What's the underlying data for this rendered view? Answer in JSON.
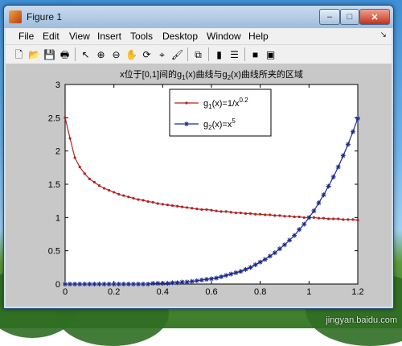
{
  "window": {
    "title": "Figure 1",
    "controls": {
      "minimize": "–",
      "maximize": "□",
      "close": "✕"
    }
  },
  "menu": [
    "File",
    "Edit",
    "View",
    "Insert",
    "Tools",
    "Desktop",
    "Window",
    "Help"
  ],
  "menu_arrow": "↘",
  "toolbar": [
    {
      "name": "new-figure-icon",
      "glyph": "🗋"
    },
    {
      "name": "open-file-icon",
      "glyph": "📂"
    },
    {
      "name": "save-icon",
      "glyph": "💾"
    },
    {
      "name": "print-icon",
      "glyph": "🖶"
    },
    {
      "sep": true
    },
    {
      "name": "edit-plot-arrow-icon",
      "glyph": "↖"
    },
    {
      "name": "zoom-in-icon",
      "glyph": "⊕"
    },
    {
      "name": "zoom-out-icon",
      "glyph": "⊖"
    },
    {
      "name": "pan-hand-icon",
      "glyph": "✋"
    },
    {
      "name": "rotate-3d-icon",
      "glyph": "⟳"
    },
    {
      "name": "data-cursor-icon",
      "glyph": "⌖"
    },
    {
      "name": "brush-icon",
      "glyph": "🖌"
    },
    {
      "sep": true
    },
    {
      "name": "link-plot-icon",
      "glyph": "⧉"
    },
    {
      "sep": true
    },
    {
      "name": "insert-colorbar-icon",
      "glyph": "▮"
    },
    {
      "name": "insert-legend-icon",
      "glyph": "☰"
    },
    {
      "sep": true
    },
    {
      "name": "hide-plot-tools-icon",
      "glyph": "■"
    },
    {
      "name": "show-plot-tools-icon",
      "glyph": "▣"
    }
  ],
  "chart_data": {
    "type": "line",
    "title": "x位于[0,1]间的g1(x)曲线与g2(x)曲线所夹的区域",
    "xlim": [
      0,
      1.2
    ],
    "ylim": [
      0,
      3
    ],
    "xticks": [
      "0",
      "0.2",
      "0.4",
      "0.6",
      "0.8",
      "1",
      "1.2"
    ],
    "yticks": [
      "0",
      "0.5",
      "1",
      "1.5",
      "2",
      "2.5",
      "3"
    ],
    "x": [
      0.02,
      0.04,
      0.06,
      0.08,
      0.1,
      0.12,
      0.14,
      0.16,
      0.18,
      0.2,
      0.22,
      0.24,
      0.26,
      0.28,
      0.3,
      0.32,
      0.34,
      0.36,
      0.38,
      0.4,
      0.42,
      0.44,
      0.46,
      0.48,
      0.5,
      0.52,
      0.54,
      0.56,
      0.58,
      0.6,
      0.62,
      0.64,
      0.66,
      0.68,
      0.7,
      0.72,
      0.74,
      0.76,
      0.78,
      0.8,
      0.82,
      0.84,
      0.86,
      0.88,
      0.9,
      0.92,
      0.94,
      0.96,
      0.98,
      1.0,
      1.02,
      1.04,
      1.06,
      1.08,
      1.1,
      1.12,
      1.14,
      1.16,
      1.18,
      1.2
    ],
    "series": [
      {
        "name": "g1(x)=1/x^0.2",
        "color": "#b22222",
        "marker": "dot",
        "values": [
          2.19,
          1.9,
          1.76,
          1.66,
          1.58,
          1.53,
          1.48,
          1.44,
          1.41,
          1.38,
          1.35,
          1.33,
          1.31,
          1.29,
          1.27,
          1.26,
          1.24,
          1.23,
          1.21,
          1.2,
          1.19,
          1.18,
          1.17,
          1.16,
          1.15,
          1.14,
          1.13,
          1.12,
          1.12,
          1.11,
          1.1,
          1.09,
          1.09,
          1.08,
          1.07,
          1.07,
          1.06,
          1.06,
          1.05,
          1.05,
          1.04,
          1.04,
          1.03,
          1.03,
          1.02,
          1.02,
          1.01,
          1.01,
          1.0,
          1.0,
          1.0,
          0.99,
          0.99,
          0.98,
          0.98,
          0.98,
          0.97,
          0.97,
          0.97,
          0.96
        ]
      },
      {
        "name": "g2(x)=x^5",
        "color": "#1a2a8c",
        "marker": "star",
        "values": [
          0.0,
          0.0,
          0.0,
          0.0,
          0.0,
          0.0,
          0.0,
          0.0,
          0.0,
          0.0,
          0.0,
          0.0,
          0.0,
          0.0,
          0.0,
          0.0,
          0.0,
          0.01,
          0.01,
          0.01,
          0.01,
          0.02,
          0.02,
          0.03,
          0.03,
          0.04,
          0.05,
          0.06,
          0.07,
          0.08,
          0.09,
          0.11,
          0.13,
          0.15,
          0.17,
          0.19,
          0.22,
          0.25,
          0.29,
          0.33,
          0.37,
          0.42,
          0.47,
          0.53,
          0.59,
          0.66,
          0.73,
          0.82,
          0.9,
          1.0,
          1.1,
          1.22,
          1.34,
          1.47,
          1.61,
          1.76,
          1.93,
          2.1,
          2.29,
          2.49
        ]
      }
    ],
    "first_point": {
      "x": 0,
      "g1": 2.5,
      "g2": 0
    },
    "legend": {
      "position": "top-center",
      "entries": [
        {
          "base": "g",
          "sub": "1",
          "mid": "(x)=1/x",
          "sup": "0.2"
        },
        {
          "base": "g",
          "sub": "2",
          "mid": "(x)=x",
          "sup": "5"
        }
      ]
    },
    "title_parts": {
      "p1": "x位于[0,1]间的g",
      "s1": "1",
      "p2": "(x)曲线与g",
      "s2": "2",
      "p3": "(x)曲线所夹的区域"
    }
  },
  "watermark": "jingyan.baidu.com"
}
